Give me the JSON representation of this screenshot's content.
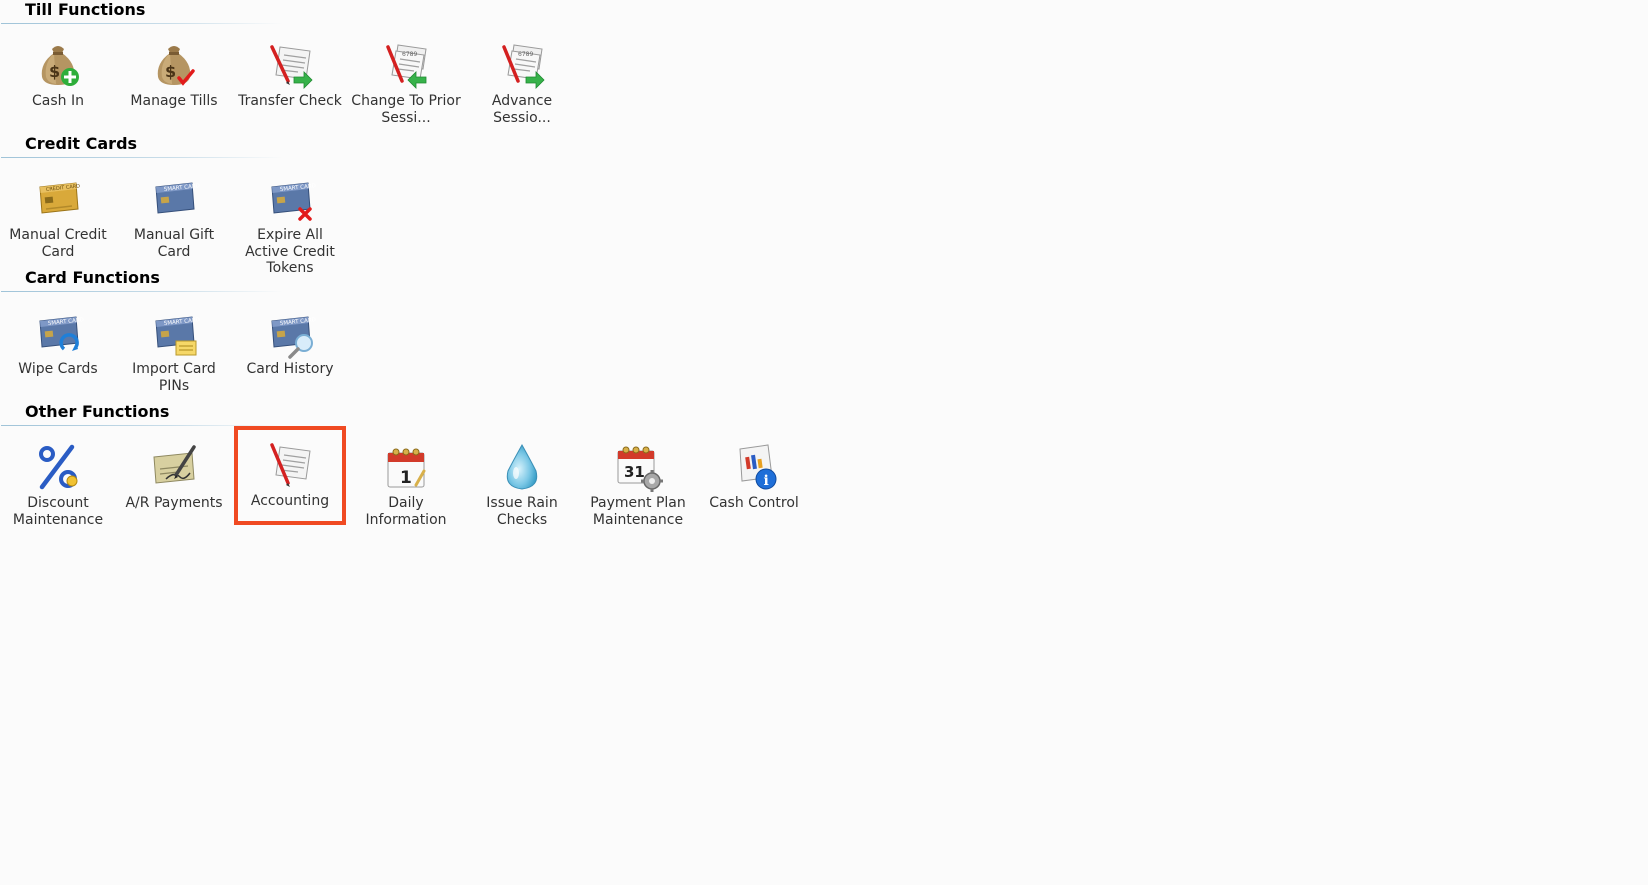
{
  "sections": [
    {
      "title": "Till Functions",
      "items": [
        {
          "label": "Cash In",
          "icon": "money-bag-add-icon"
        },
        {
          "label": "Manage Tills",
          "icon": "money-bag-check-icon"
        },
        {
          "label": "Transfer Check",
          "icon": "check-transfer-icon"
        },
        {
          "label": "Change To Prior Sessi...",
          "icon": "check-back-arrow-icon"
        },
        {
          "label": "Advance Sessio...",
          "icon": "check-forward-arrow-icon"
        }
      ]
    },
    {
      "title": "Credit Cards",
      "items": [
        {
          "label": "Manual Credit Card",
          "icon": "gold-credit-card-icon"
        },
        {
          "label": "Manual Gift Card",
          "icon": "smart-card-icon"
        },
        {
          "label": "Expire All Active Credit Tokens",
          "icon": "smart-card-delete-icon"
        }
      ]
    },
    {
      "title": "Card Functions",
      "items": [
        {
          "label": "Wipe Cards",
          "icon": "smart-card-refresh-icon"
        },
        {
          "label": "Import Card PINs",
          "icon": "smart-card-import-icon"
        },
        {
          "label": "Card History",
          "icon": "smart-card-search-icon"
        }
      ]
    },
    {
      "title": "Other Functions",
      "items": [
        {
          "label": "Discount Maintenance",
          "icon": "percent-icon"
        },
        {
          "label": "A/R Payments",
          "icon": "check-signing-icon"
        },
        {
          "label": "Accounting",
          "icon": "ledger-pencil-icon",
          "selected": true
        },
        {
          "label": "Daily Information",
          "icon": "calendar-day-icon"
        },
        {
          "label": "Issue Rain Checks",
          "icon": "water-drop-icon"
        },
        {
          "label": "Payment Plan Maintenance",
          "icon": "calendar-gear-icon"
        },
        {
          "label": "Cash Control",
          "icon": "report-info-icon"
        }
      ]
    }
  ],
  "colors": {
    "selection_border": "#f04a22",
    "section_rule": "#9fc3d8"
  }
}
